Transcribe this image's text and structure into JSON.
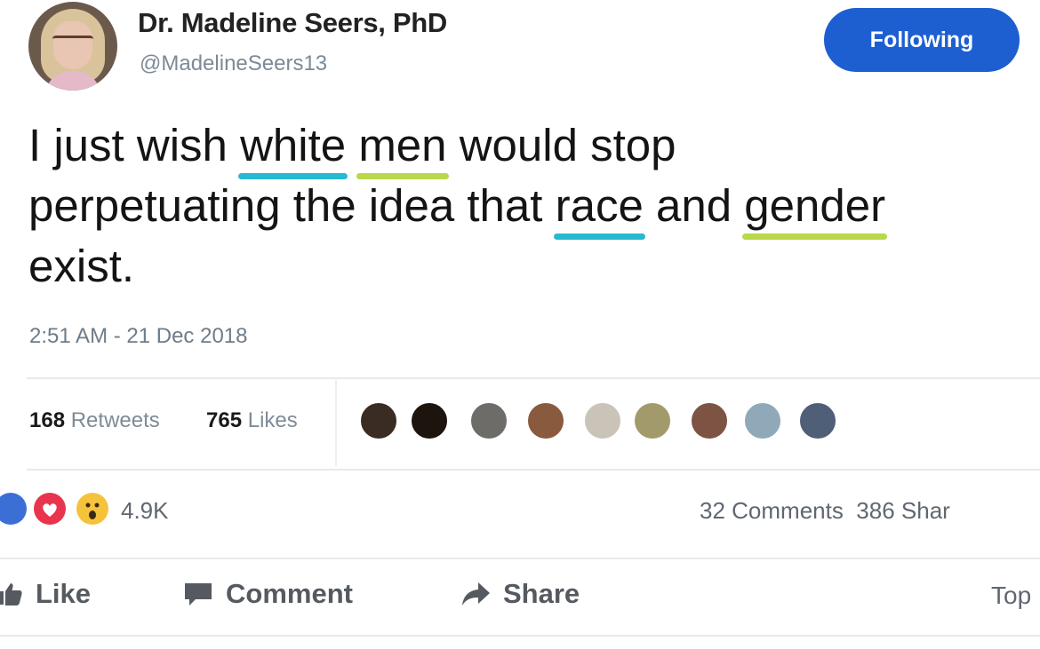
{
  "profile": {
    "name": "Dr. Madeline Seers, PhD",
    "handle": "@MadelineSeers13",
    "follow_label": "Following"
  },
  "tweet": {
    "line1": {
      "a": "I just wish ",
      "b": "white",
      "c": " ",
      "d": "men",
      "e": " would stop"
    },
    "line2": {
      "a": "perpetuating the idea that ",
      "b": "race",
      "c": " and ",
      "d": "gender"
    },
    "line3": "exist.",
    "timestamp": "2:51 AM - 21 Dec 2018"
  },
  "stats": {
    "retweets_count": "168",
    "retweets_label": "Retweets",
    "likes_count": "765",
    "likes_label": "Likes",
    "liker_avatars": [
      "avatar-1",
      "avatar-2",
      "avatar-3",
      "avatar-4",
      "avatar-5",
      "avatar-6",
      "avatar-7",
      "avatar-8",
      "avatar-9"
    ]
  },
  "facebook": {
    "reactions_count": "4.9K",
    "comments_count": "32 Comments",
    "shares_count": "386 Shar",
    "actions": {
      "like": "Like",
      "comment": "Comment",
      "share": "Share",
      "top": "Top"
    }
  },
  "colors": {
    "follow_button": "#1d5fd0",
    "underline_cyan": "#28b9d0",
    "underline_lime": "#b9d84a",
    "muted_text": "#7c8a97"
  }
}
